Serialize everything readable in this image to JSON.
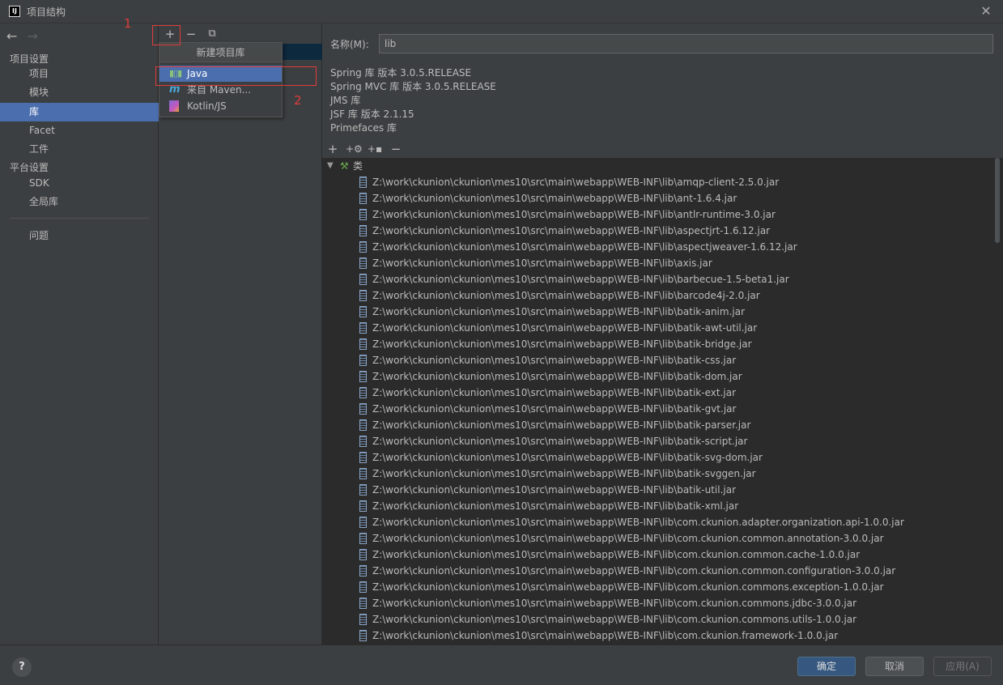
{
  "window": {
    "title": "项目结构",
    "close_glyph": "✕",
    "app_icon_text": "IJ"
  },
  "sidebar": {
    "back_glyph": "←",
    "forward_glyph": "→",
    "project_settings_header": "项目设置",
    "platform_settings_header": "平台设置",
    "items": [
      {
        "label": "项目"
      },
      {
        "label": "模块"
      },
      {
        "label": "库"
      },
      {
        "label": "Facet"
      },
      {
        "label": "工件"
      },
      {
        "label": "SDK"
      },
      {
        "label": "全局库"
      },
      {
        "label": "问题"
      }
    ]
  },
  "middle_toolbar": {
    "add_glyph": "+",
    "remove_glyph": "−",
    "copy_glyph": "⧉"
  },
  "popup": {
    "title": "新建项目库",
    "items": [
      {
        "label": "Java",
        "icon": "java-library-icon"
      },
      {
        "label": "来自 Maven...",
        "icon": "maven-icon"
      },
      {
        "label": "Kotlin/JS",
        "icon": "kotlin-js-icon"
      }
    ]
  },
  "annotations": {
    "step1": "1",
    "step2": "2",
    "color": "#e03c3c"
  },
  "detail": {
    "name_label": "名称(M):",
    "name_value": "lib",
    "info_lines": [
      "Spring 库  版本 3.0.5.RELEASE",
      "Spring MVC 库  版本 3.0.5.RELEASE",
      "JMS 库",
      "JSF 库  版本 2.1.15",
      "Primefaces 库"
    ],
    "toolbar": {
      "add": "+",
      "add_spec": "+⚙",
      "add_jar": "+▪",
      "remove": "−"
    },
    "tree_root_label": "类",
    "jar_prefix": "Z:\\work\\ckunion\\ckunion\\mes10\\src\\main\\webapp\\WEB-INF\\lib\\",
    "jars": [
      "amqp-client-2.5.0.jar",
      "ant-1.6.4.jar",
      "antlr-runtime-3.0.jar",
      "aspectjrt-1.6.12.jar",
      "aspectjweaver-1.6.12.jar",
      "axis.jar",
      "barbecue-1.5-beta1.jar",
      "barcode4j-2.0.jar",
      "batik-anim.jar",
      "batik-awt-util.jar",
      "batik-bridge.jar",
      "batik-css.jar",
      "batik-dom.jar",
      "batik-ext.jar",
      "batik-gvt.jar",
      "batik-parser.jar",
      "batik-script.jar",
      "batik-svg-dom.jar",
      "batik-svggen.jar",
      "batik-util.jar",
      "batik-xml.jar",
      "com.ckunion.adapter.organization.api-1.0.0.jar",
      "com.ckunion.common.annotation-3.0.0.jar",
      "com.ckunion.common.cache-1.0.0.jar",
      "com.ckunion.common.configuration-3.0.0.jar",
      "com.ckunion.commons.exception-1.0.0.jar",
      "com.ckunion.commons.jdbc-3.0.0.jar",
      "com.ckunion.commons.utils-1.0.0.jar",
      "com.ckunion.framework-1.0.0.jar"
    ]
  },
  "footer": {
    "help": "?",
    "ok": "确定",
    "cancel": "取消",
    "apply": "应用(A)"
  }
}
